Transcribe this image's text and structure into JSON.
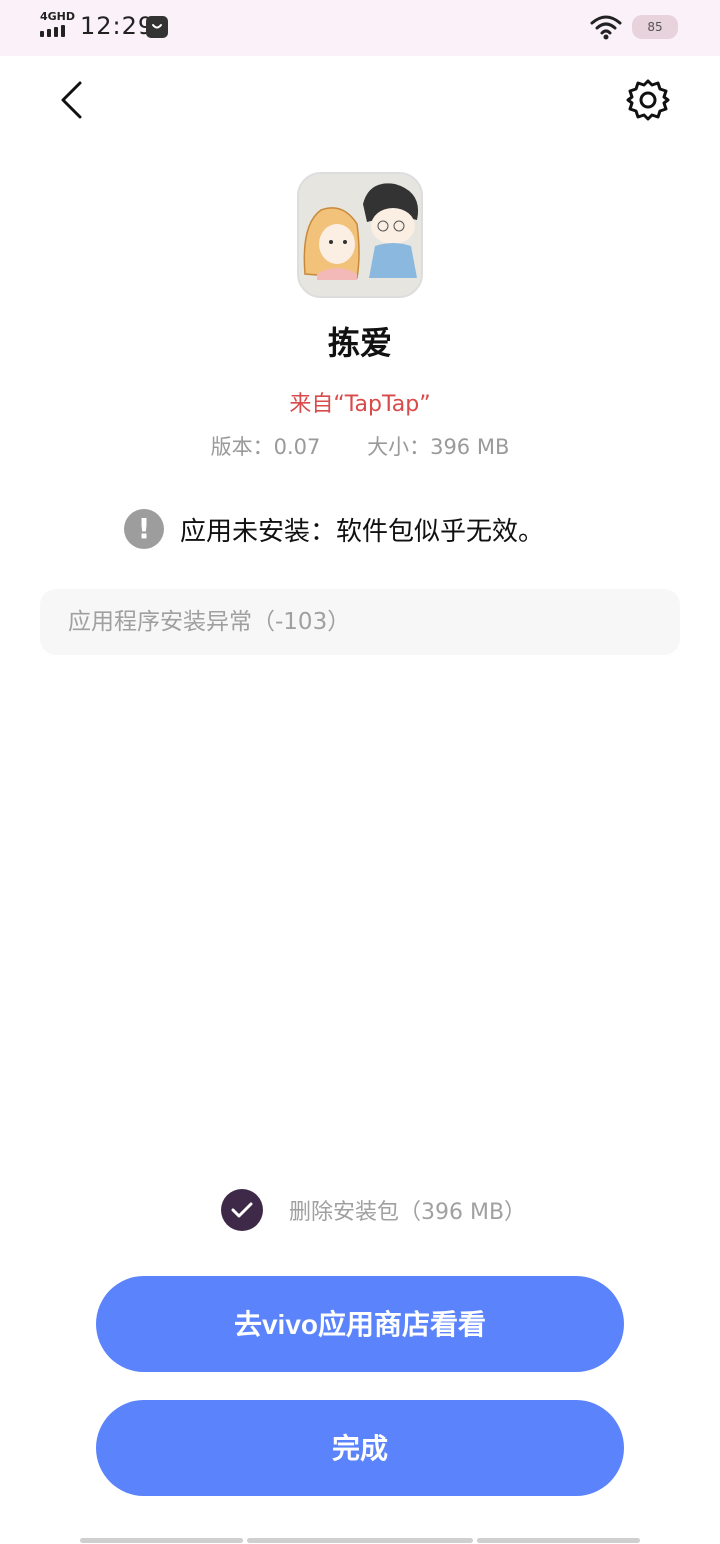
{
  "status_bar": {
    "network": "4GHD",
    "time": "12:29",
    "battery": "85"
  },
  "app": {
    "name": "拣爱",
    "source": "来自“TapTap”",
    "version": "版本：0.07",
    "size": "大小：396 MB"
  },
  "error": {
    "icon_glyph": "!",
    "message": "应用未安装：软件包似乎无效。",
    "detail": "应用程序安装异常（-103）"
  },
  "delete_package": {
    "label": "删除安装包（396 MB）",
    "checked": true
  },
  "buttons": {
    "store": "去vivo应用商店看看",
    "done": "完成"
  },
  "colors": {
    "accent": "#5b83fb",
    "source_text": "#d94a4a",
    "checkbox": "#3e2a48",
    "status_bar_bg": "#fbf2f9"
  }
}
